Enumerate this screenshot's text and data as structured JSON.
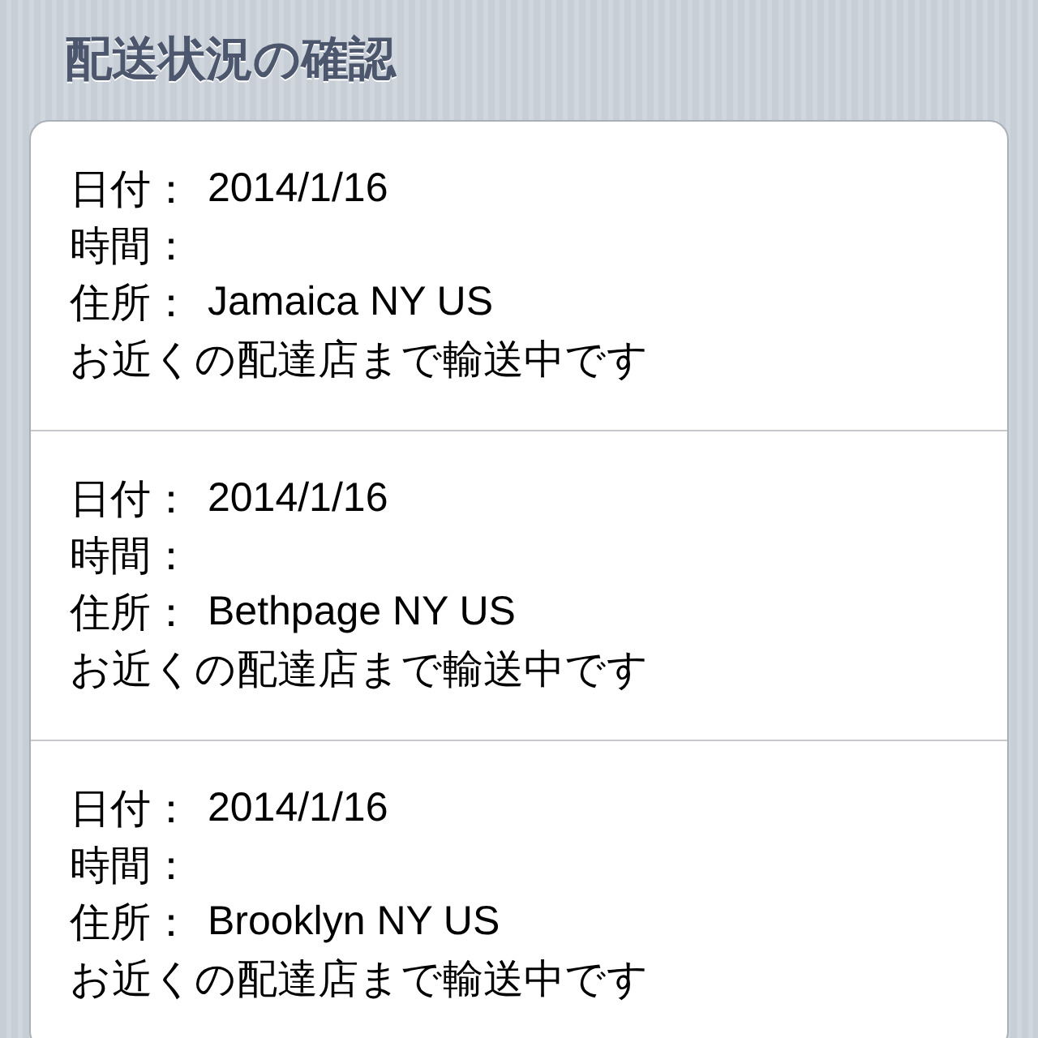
{
  "section_header": "配送状況の確認",
  "rows": [
    {
      "date_label": "日付：",
      "date": "2014/1/16",
      "time_label": "時間：",
      "address_label": "住所：",
      "address": "Jamaica NY US",
      "status": "お近くの配達店まで輸送中です"
    },
    {
      "date_label": "日付：",
      "date": "2014/1/16",
      "time_label": "時間：",
      "address_label": "住所：",
      "address": "Bethpage NY US",
      "status": "お近くの配達店まで輸送中です"
    },
    {
      "date_label": "日付：",
      "date": "2014/1/16",
      "time_label": "時間：",
      "address_label": "住所：",
      "address": "Brooklyn NY US",
      "status": "お近くの配達店まで輸送中です"
    }
  ]
}
